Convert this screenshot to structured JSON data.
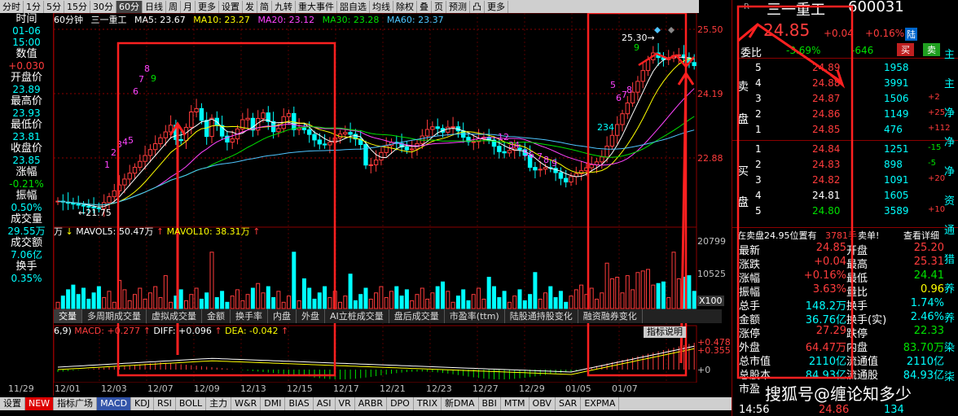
{
  "toolbar": {
    "items": [
      "分时",
      "1分",
      "5分",
      "15分",
      "30分",
      "60分",
      "日线",
      "周",
      "月",
      "更多",
      "设置",
      "发",
      "简",
      "九转",
      "重大事件",
      "㗊自选",
      "均线",
      "除权",
      "叠",
      "页",
      "预测",
      "凸",
      "更多"
    ],
    "active_index": 5
  },
  "header": {
    "period": "60分钟",
    "name": "三一重工",
    "ma5": "MA5: 23.67",
    "ma10": "MA10: 23.27",
    "ma20": "MA20: 23.12",
    "ma30": "MA30: 23.28",
    "ma60": "MA60: 23.37"
  },
  "left_panel": [
    {
      "label": "时间",
      "value": "01-06"
    },
    {
      "label": "",
      "value": "15:00"
    },
    {
      "label": "数值",
      "value": "+0.030"
    },
    {
      "label": "开盘价",
      "value": "23.89"
    },
    {
      "label": "最高价",
      "value": "23.93"
    },
    {
      "label": "最低价",
      "value": "23.81"
    },
    {
      "label": "收盘价",
      "value": "23.85"
    },
    {
      "label": "涨幅",
      "value": "-0.21%"
    },
    {
      "label": "振幅",
      "value": "0.50%"
    },
    {
      "label": "成交量",
      "value": "29.55万"
    },
    {
      "label": "成交额",
      "value": "7.06亿"
    },
    {
      "label": "换手",
      "value": "0.35%"
    }
  ],
  "price_axis": {
    "top": "25.50",
    "mid": "24.19",
    "low": "22.88"
  },
  "vol_axis": {
    "top": "20799",
    "mid": "10525",
    "unit": "X100"
  },
  "macd_axis": {
    "top": "+0.478",
    "mid": "+0.355",
    "zero": "+0"
  },
  "annotations": {
    "high": "25.30",
    "low": "21.75",
    "rise_seq": [
      "1",
      "2",
      "3",
      "4",
      "5",
      "6",
      "7",
      "8",
      "9"
    ],
    "rise2_seq": [
      "5",
      "6",
      "7",
      "8",
      "9"
    ],
    "fall_seq": [
      "1",
      "2",
      "3",
      "4",
      "5",
      "6",
      "7",
      "8",
      "9"
    ],
    "seq_234": "234"
  },
  "vol_legend": {
    "prefix": "万",
    "mavol5": "MAVOL5: 50.47万",
    "mavol10": "MAVOL10: 38.31万"
  },
  "indicator_tabs": [
    "交量",
    "多周期成交量",
    "虚拟成交量",
    "金额",
    "换手率",
    "内盘",
    "外盘",
    "AI立桩成交量",
    "盘后成交量",
    "市盈率(ttm)",
    "陆股通持股变化",
    "融资融券变化"
  ],
  "indicator_button": "指标说明",
  "macd_legend": {
    "params": "6,9)",
    "macd": "MACD: +0.277",
    "diff": "DIFF: +0.096",
    "dea": "DEA: -0.042"
  },
  "dates": [
    "11/29",
    "12/01",
    "12/03",
    "12/07",
    "12/09",
    "12/13",
    "12/15",
    "12/17",
    "12/21",
    "12/23",
    "12/27",
    "12/29",
    "01/05",
    "01/07"
  ],
  "bottom_tabs": [
    "设置",
    "NEW",
    "指标广场",
    "MACD",
    "KDJ",
    "RSI",
    "BOLL",
    "主力",
    "W&R",
    "DMI",
    "BIAS",
    "ASI",
    "VR",
    "ARBR",
    "DPO",
    "TRIX",
    "新DMA",
    "BBI",
    "MTM",
    "OBV",
    "SAR",
    "EXPMA"
  ],
  "bottom_active": 3,
  "stock": {
    "name": "三一重工",
    "code": "600031",
    "price": "24.85",
    "change": "+0.04",
    "pct": "+0.16%",
    "tag": "陆",
    "webi_label": "委比",
    "webi": "-3.69%",
    "weicha": "-646",
    "buy_btn": "买",
    "sell_btn": "卖"
  },
  "asks": [
    {
      "level": "5",
      "price": "24.89",
      "vol": "1958",
      "chg": ""
    },
    {
      "level": "4",
      "price": "24.88",
      "vol": "3991",
      "chg": ""
    },
    {
      "level": "3",
      "price": "24.87",
      "vol": "1506",
      "chg": "+2"
    },
    {
      "level": "2",
      "price": "24.86",
      "vol": "1149",
      "chg": "+25"
    },
    {
      "level": "1",
      "price": "24.85",
      "vol": "476",
      "chg": "+112"
    }
  ],
  "bids": [
    {
      "level": "1",
      "price": "24.84",
      "vol": "1251",
      "chg": "-15"
    },
    {
      "level": "2",
      "price": "24.83",
      "vol": "898",
      "chg": "-5"
    },
    {
      "level": "3",
      "price": "24.82",
      "vol": "1091",
      "chg": "+20"
    },
    {
      "level": "4",
      "price": "24.81",
      "vol": "1605",
      "chg": ""
    },
    {
      "level": "5",
      "price": "24.80",
      "vol": "3589",
      "chg": "+10"
    }
  ],
  "sell_label": [
    "卖",
    "盘"
  ],
  "buy_label": [
    "买",
    "盘"
  ],
  "notice": {
    "text": "在卖盘24.95位置有",
    "vol": "3781手",
    "action": "卖单!",
    "detail": "查看详细"
  },
  "quotes": [
    {
      "l1": "最新",
      "v1": "24.85",
      "c1": "red",
      "l2": "开盘",
      "v2": "25.20",
      "c2": "red"
    },
    {
      "l1": "涨跌",
      "v1": "+0.04",
      "c1": "red",
      "l2": "最高",
      "v2": "25.31",
      "c2": "red"
    },
    {
      "l1": "涨幅",
      "v1": "+0.16%",
      "c1": "red",
      "l2": "最低",
      "v2": "24.41",
      "c2": "green"
    },
    {
      "l1": "振幅",
      "v1": "3.63%",
      "c1": "red",
      "l2": "量比",
      "v2": "0.96",
      "c2": "yellow"
    },
    {
      "l1": "总手",
      "v1": "148.2万",
      "c1": "cyan",
      "l2": "换手",
      "v2": "1.74%",
      "c2": "cyan"
    },
    {
      "l1": "金额",
      "v1": "36.76亿",
      "c1": "cyan",
      "l2": "换手(实)",
      "v2": "2.46%",
      "c2": "cyan"
    },
    {
      "l1": "涨停",
      "v1": "27.29",
      "c1": "red",
      "l2": "跌停",
      "v2": "22.33",
      "c2": "green"
    },
    {
      "l1": "外盘",
      "v1": "64.47万",
      "c1": "red",
      "l2": "内盘",
      "v2": "83.70万",
      "c2": "green"
    },
    {
      "l1": "总市值",
      "v1": "2110亿",
      "c1": "cyan",
      "l2": "流通值",
      "v2": "2110亿",
      "c2": "cyan"
    },
    {
      "l1": "总股本",
      "v1": "84.93亿",
      "c1": "cyan",
      "l2": "流通股",
      "v2": "84.93亿",
      "c2": "cyan"
    },
    {
      "l1": "市盈",
      "v1": "",
      "c1": "cyan",
      "l2": "",
      "v2": "",
      "c2": "cyan"
    }
  ],
  "last_trade": {
    "time": "14:56",
    "price": "24.86",
    "vol": "134"
  },
  "edge_labels": [
    "主",
    "主",
    "净",
    "净",
    "净",
    "资",
    "通",
    "猎",
    "养",
    "养",
    "染",
    "柒"
  ],
  "watermark": "搜狐号@缠论知多少"
}
